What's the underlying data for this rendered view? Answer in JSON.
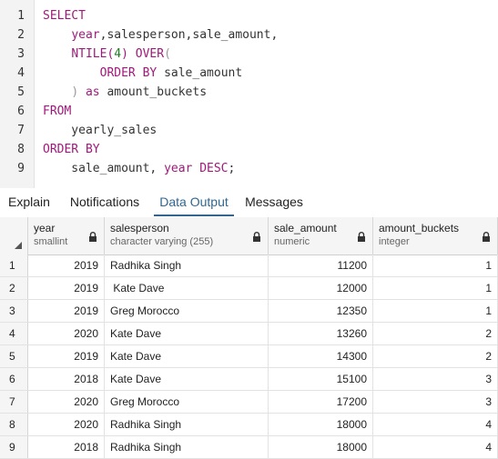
{
  "editor": {
    "line_numbers": [
      "1",
      "2",
      "3",
      "4",
      "5",
      "6",
      "7",
      "8",
      "9"
    ],
    "lines": [
      [
        {
          "t": "SELECT",
          "c": "kw"
        }
      ],
      [
        {
          "t": "    ",
          "c": "plain"
        },
        {
          "t": "year",
          "c": "kw"
        },
        {
          "t": ",salesperson,sale_amount,",
          "c": "plain"
        }
      ],
      [
        {
          "t": "    ",
          "c": "plain"
        },
        {
          "t": "NTILE(",
          "c": "kw"
        },
        {
          "t": "4",
          "c": "num"
        },
        {
          "t": ") OVER",
          "c": "kw"
        },
        {
          "t": "(",
          "c": "paren"
        }
      ],
      [
        {
          "t": "        ",
          "c": "plain"
        },
        {
          "t": "ORDER BY",
          "c": "kw"
        },
        {
          "t": " sale_amount",
          "c": "plain"
        }
      ],
      [
        {
          "t": "    ",
          "c": "plain"
        },
        {
          "t": ")",
          "c": "paren"
        },
        {
          "t": " as",
          "c": "kw"
        },
        {
          "t": " amount_buckets",
          "c": "plain"
        }
      ],
      [
        {
          "t": "FROM",
          "c": "kw"
        }
      ],
      [
        {
          "t": "    yearly_sales",
          "c": "plain"
        }
      ],
      [
        {
          "t": "ORDER BY",
          "c": "kw"
        }
      ],
      [
        {
          "t": "    sale_amount, ",
          "c": "plain"
        },
        {
          "t": "year DESC",
          "c": "kw"
        },
        {
          "t": ";",
          "c": "plain"
        }
      ]
    ]
  },
  "tabs": {
    "explain": "Explain",
    "notifications": "Notifications",
    "data_output": "Data Output",
    "messages": "Messages",
    "active": "Data Output"
  },
  "grid": {
    "columns": [
      {
        "name": "year",
        "type": "smallint"
      },
      {
        "name": "salesperson",
        "type": "character varying (255)"
      },
      {
        "name": "sale_amount",
        "type": "numeric"
      },
      {
        "name": "amount_buckets",
        "type": "integer"
      }
    ],
    "rows": [
      {
        "n": "1",
        "year": "2019",
        "salesperson": "Radhika Singh",
        "sale_amount": "11200",
        "amount_buckets": "1"
      },
      {
        "n": "2",
        "year": "2019",
        "salesperson": " Kate Dave",
        "sale_amount": "12000",
        "amount_buckets": "1"
      },
      {
        "n": "3",
        "year": "2019",
        "salesperson": "Greg Morocco",
        "sale_amount": "12350",
        "amount_buckets": "1"
      },
      {
        "n": "4",
        "year": "2020",
        "salesperson": "Kate Dave",
        "sale_amount": "13260",
        "amount_buckets": "2"
      },
      {
        "n": "5",
        "year": "2019",
        "salesperson": "Kate Dave",
        "sale_amount": "14300",
        "amount_buckets": "2"
      },
      {
        "n": "6",
        "year": "2018",
        "salesperson": "Kate Dave",
        "sale_amount": "15100",
        "amount_buckets": "3"
      },
      {
        "n": "7",
        "year": "2020",
        "salesperson": "Greg Morocco",
        "sale_amount": "17200",
        "amount_buckets": "3"
      },
      {
        "n": "8",
        "year": "2020",
        "salesperson": "Radhika Singh",
        "sale_amount": "18000",
        "amount_buckets": "4"
      },
      {
        "n": "9",
        "year": "2018",
        "salesperson": "Radhika Singh",
        "sale_amount": "18000",
        "amount_buckets": "4"
      }
    ]
  },
  "colors": {
    "keyword": "#a0197a",
    "number": "#1d7d20",
    "tab_active": "#326690"
  },
  "icons": {
    "column_lock": "lock-icon",
    "sort": "sort-triangle-icon"
  }
}
